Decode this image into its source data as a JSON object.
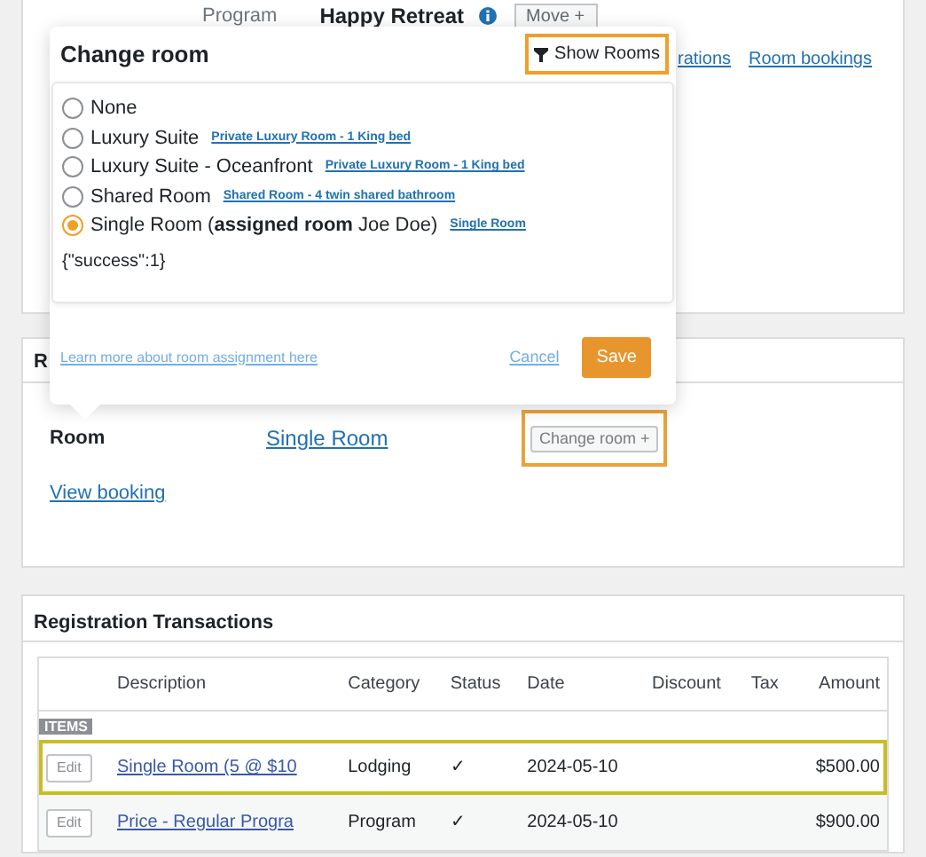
{
  "background_page": {
    "program_label": "Program",
    "program_name": "Happy Retreat",
    "move_button": "Move +",
    "links": [
      "rations",
      "Room bookings"
    ]
  },
  "room_card": {
    "title": "R",
    "room_label": "Room",
    "room_value": "Single Room",
    "change_button": {
      "label": "Change room +",
      "highlighted": true
    },
    "view_link": "View booking"
  },
  "popover": {
    "title": "Change room",
    "show_rooms_button": {
      "label": "Show Rooms",
      "highlighted": true
    },
    "options": [
      {
        "label": "None",
        "selected": false
      },
      {
        "label": "Luxury Suite",
        "link": "Private Luxury Room - 1 King bed",
        "selected": false
      },
      {
        "label": "Luxury Suite - Oceanfront",
        "link": "Private Luxury Room - 1 King bed",
        "selected": false
      },
      {
        "label": "Shared Room",
        "link": "Shared Room - 4 twin shared bathroom",
        "selected": false
      },
      {
        "label": "Single Room (**assigned room** Joe Doe)",
        "link": "Single Room",
        "selected": true
      }
    ],
    "result": "{\"success\":1}",
    "learn_more": "Learn more about room assignment here",
    "cancel": "Cancel",
    "save": "Save"
  },
  "transactions": {
    "title": "Registration Transactions",
    "columns": [
      "Description",
      "Category",
      "Status",
      "Date",
      "Discount",
      "Tax",
      "Amount"
    ],
    "group": "ITEMS",
    "rows": [
      {
        "edit": "Edit",
        "description": "Single Room (5 @ $10",
        "category": "Lodging",
        "status": "✓",
        "date": "2024-05-10",
        "amount": "$500.00",
        "highlighted": true
      },
      {
        "edit": "Edit",
        "description": "Price - Regular Progra",
        "category": "Program",
        "status": "✓",
        "date": "2024-05-10",
        "amount": "$900.00",
        "highlighted": false
      }
    ]
  }
}
